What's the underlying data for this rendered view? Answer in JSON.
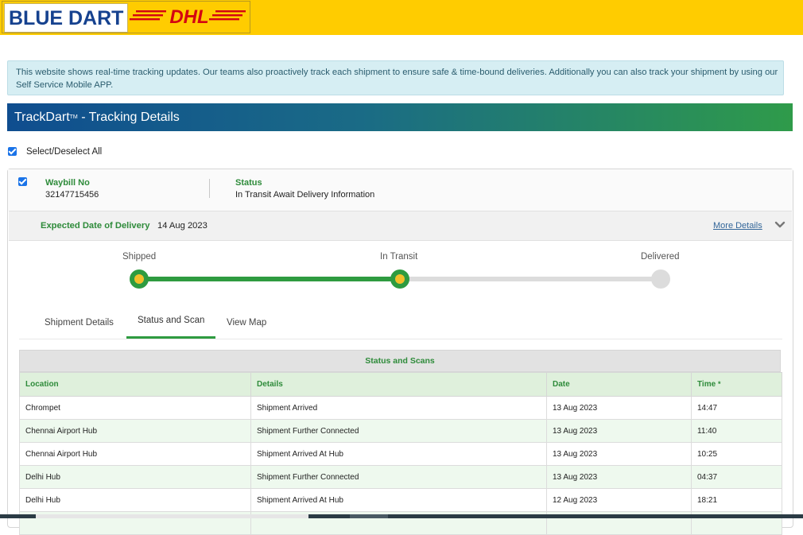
{
  "brand": {
    "bluedart_text": "BLUE DART",
    "dhl_text": "DHL",
    "colors": {
      "topbar": "#ffcc00",
      "bluedart": "#16428f",
      "dhl_red": "#d40511",
      "green": "#2e9b40",
      "link": "#336699"
    }
  },
  "info_alert": {
    "text": "This website shows real-time tracking updates. Our teams also proactively track each shipment to ensure safe & time-bound deliveries. Additionally you can also track your shipment by using our Self Service Mobile APP."
  },
  "header": {
    "title_prefix": "TrackDart",
    "title_tm": "TM",
    "title_suffix": " - Tracking Details"
  },
  "select_all": {
    "label": "Select/Deselect All",
    "checked": true
  },
  "shipment": {
    "checked": true,
    "waybill_label": "Waybill No",
    "waybill_value": "32147715456",
    "status_label": "Status",
    "status_value": "In Transit Await Delivery Information",
    "edd_label": "Expected Date of Delivery",
    "edd_value": "14 Aug 2023",
    "more_details": "More Details",
    "progress": {
      "steps": [
        {
          "label": "Shipped",
          "state": "done"
        },
        {
          "label": "In Transit",
          "state": "done"
        },
        {
          "label": "Delivered",
          "state": "todo"
        }
      ]
    },
    "tabs": [
      {
        "label": "Shipment Details",
        "active": false
      },
      {
        "label": "Status and Scan",
        "active": true
      },
      {
        "label": "View Map",
        "active": false
      }
    ],
    "scans": {
      "title": "Status and Scans",
      "columns": [
        "Location",
        "Details",
        "Date",
        "Time"
      ],
      "sort_marker": "*",
      "rows": [
        [
          "Chrompet",
          "Shipment Arrived",
          "13 Aug 2023",
          "14:47"
        ],
        [
          "Chennai Airport Hub",
          "Shipment Further Connected",
          "13 Aug 2023",
          "11:40"
        ],
        [
          "Chennai Airport Hub",
          "Shipment Arrived At Hub",
          "13 Aug 2023",
          "10:25"
        ],
        [
          "Delhi Hub",
          "Shipment Further Connected",
          "13 Aug 2023",
          "04:37"
        ],
        [
          "Delhi Hub",
          "Shipment Arrived At Hub",
          "12 Aug 2023",
          "18:21"
        ],
        [
          "",
          "",
          "",
          ""
        ]
      ]
    }
  }
}
